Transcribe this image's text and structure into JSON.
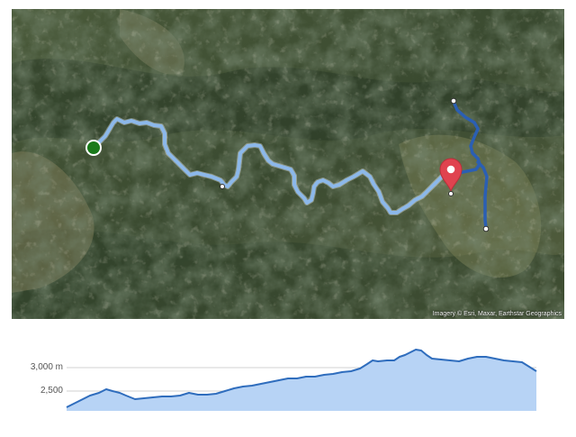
{
  "map": {
    "attribution": "Imagery © Esri, Maxar, Earthstar Geographics",
    "imagery": "satellite",
    "start_marker_color": "#1a7a1a",
    "destination_marker_color": "#e0434f",
    "route_light_color": "#8cb8ea",
    "route_dark_color": "#2b5fb3",
    "icons": [
      "start-marker-icon",
      "destination-pin-icon",
      "waypoint-dot-icon"
    ]
  },
  "elevation": {
    "y_tick_labels": [
      "3,000 m",
      "2,500"
    ],
    "y_tick_values": [
      3000,
      2500
    ],
    "fill_color": "#b7d3f5",
    "line_color": "#2f6dbd"
  }
}
